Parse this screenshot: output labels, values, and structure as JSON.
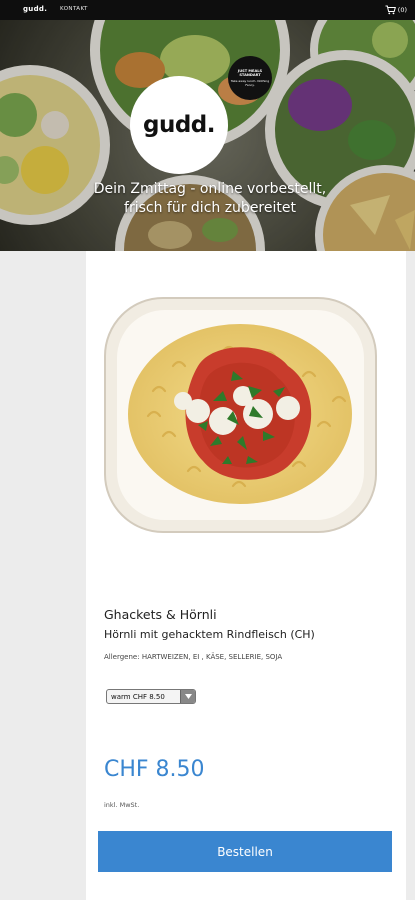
{
  "nav": {
    "brand": "gudd.",
    "contact_label": "KONTAKT",
    "cart_count": "(0)",
    "cart_icon": "shopping-cart-icon"
  },
  "hero": {
    "logo_text": "gudd.",
    "stamp_line1": "JUST MEALS STANDART",
    "stamp_line2": "Take away lunch. Nothing Fancy.",
    "tagline_line1": "Dein Zmittag - online vorbestellt,",
    "tagline_line2": "frisch für dich zubereitet"
  },
  "product": {
    "category": "Ghackets & Hörnli",
    "name": "Hörnli mit gehacktem Rindfleisch (CH)",
    "allergens": "Allergene: HARTWEIZEN, EI , KÄSE, SELLERIE, SOJA",
    "variant_selected": "warm CHF 8.50",
    "price": "CHF 8.50",
    "vat_note": "inkl. MwSt.",
    "order_label": "Bestellen"
  },
  "colors": {
    "accent": "#3a86d0",
    "topbar": "#0e0e0e"
  }
}
